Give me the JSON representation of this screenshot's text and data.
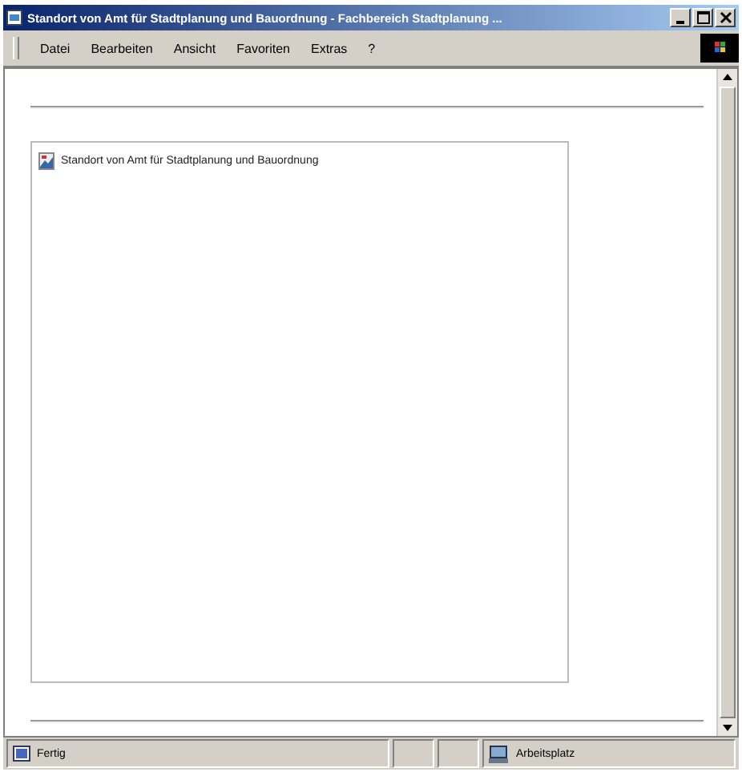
{
  "window": {
    "title": "Standort von Amt für Stadtplanung und Bauordnung - Fachbereich Stadtplanung ..."
  },
  "menu": [
    "Datei",
    "Bearbeiten",
    "Ansicht",
    "Favoriten",
    "Extras",
    "?"
  ],
  "content": {
    "image_alt": "Standort von Amt für Stadtplanung und Bauordnung"
  },
  "status_bar": {
    "text": "Fertig",
    "zone": "Arbeitsplatz"
  }
}
